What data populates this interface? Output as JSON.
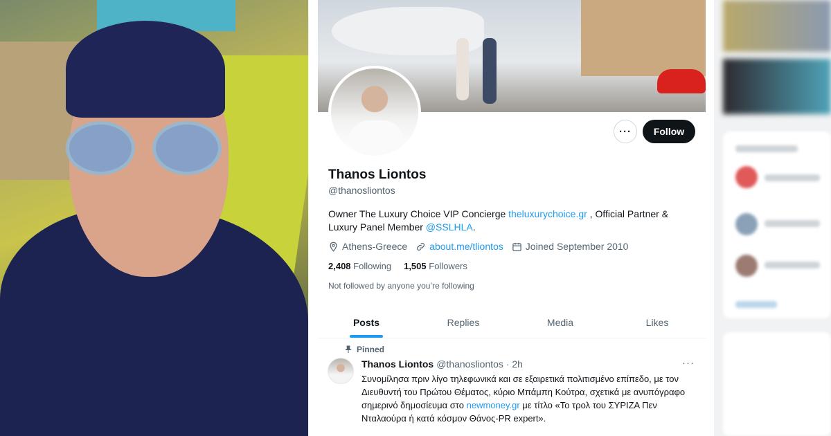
{
  "profile": {
    "name": "Thanos Liontos",
    "handle": "@thanosliontos",
    "bio_part1": "Owner The Luxury Choice VIP Concierge ",
    "bio_link1": "theluxurychoice.gr",
    "bio_part2": " , Official Partner & Luxury Panel Member ",
    "bio_link2": "@SSLHLA",
    "bio_part3": ".",
    "location": "Athens-Greece",
    "website": "about.me/tliontos",
    "joined": "Joined September 2010",
    "following_count": "2,408",
    "following_label": "Following",
    "followers_count": "1,505",
    "followers_label": "Followers",
    "not_followed": "Not followed by anyone you’re following",
    "follow_label": "Follow",
    "more_label": "···"
  },
  "tabs": [
    {
      "label": "Posts"
    },
    {
      "label": "Replies"
    },
    {
      "label": "Media"
    },
    {
      "label": "Likes"
    }
  ],
  "post": {
    "pinned_label": "Pinned",
    "author": "Thanos Liontos",
    "handle_time": "@thanosliontos · 2h",
    "more": "···",
    "text_part1": "Συνομίλησα πριν λίγο τηλεφωνικά και σε εξαιρετικά πολιτισμένο επίπεδο, με τον Διευθυντή του Πρώτου Θέματος, κύριο Μπάμπη Κούτρα, σχετικά με ανυπόγραφο σημερινό δημοσίευμα στο ",
    "text_link": "newmoney.gr",
    "text_part2": " με τίτλο «Το τρολ του ΣΥΡΙΖΑ Πεν Νταλαούρα ή κατά κόσμον Θάνος-PR expert»."
  },
  "colors": {
    "accent": "#1d9bf0",
    "text": "#0f1419",
    "secondary": "#536471"
  },
  "icons": {
    "location": "location-pin-icon",
    "website": "link-icon",
    "joined": "calendar-icon",
    "pinned": "pin-icon"
  }
}
